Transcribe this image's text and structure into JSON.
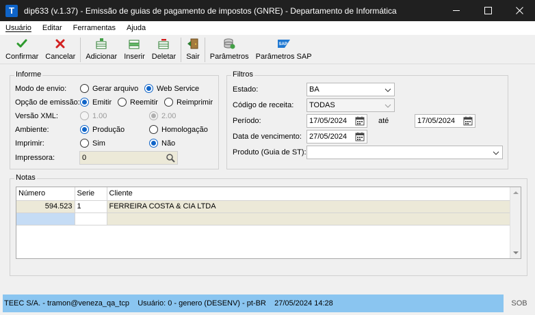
{
  "window": {
    "title": "dip633 (v.1.37) - Emissão de guias de pagamento de impostos (GNRE) - Departamento de Informática",
    "app_icon_letter": "T"
  },
  "menu": [
    "Usuário",
    "Editar",
    "Ferramentas",
    "Ajuda"
  ],
  "toolbar": {
    "confirmar": "Confirmar",
    "cancelar": "Cancelar",
    "adicionar": "Adicionar",
    "inserir": "Inserir",
    "deletar": "Deletar",
    "sair": "Sair",
    "parametros": "Parâmetros",
    "parametros_sap": "Parâmetros SAP",
    "sap_badge": "SAP"
  },
  "informe": {
    "title": "Informe",
    "modo_envio": {
      "label": "Modo de envio:",
      "opt1": "Gerar arquivo",
      "opt2": "Web Service",
      "selected": "Web Service"
    },
    "opcao_emissao": {
      "label": "Opção de emissão:",
      "opt1": "Emitir",
      "opt2": "Reemitir",
      "opt3": "Reimprimir",
      "selected": "Emitir"
    },
    "versao_xml": {
      "label": "Versão XML:",
      "opt1": "1.00",
      "opt2": "2.00",
      "selected": "2.00"
    },
    "ambiente": {
      "label": "Ambiente:",
      "opt1": "Produção",
      "opt2": "Homologação",
      "selected": "Produção"
    },
    "imprimir": {
      "label": "Imprimir:",
      "opt1": "Sim",
      "opt2": "Não",
      "selected": "Não"
    },
    "impressora": {
      "label": "Impressora:",
      "value": "0"
    }
  },
  "filtros": {
    "title": "Filtros",
    "estado": {
      "label": "Estado:",
      "value": "BA"
    },
    "codigo_receita": {
      "label": "Código de receita:",
      "value": "TODAS"
    },
    "periodo": {
      "label": "Período:",
      "from": "17/05/2024",
      "ate": "até",
      "to": "17/05/2024"
    },
    "vencimento": {
      "label": "Data de vencimento:",
      "value": "27/05/2024"
    },
    "produto": {
      "label": "Produto (Guia de ST):",
      "value": ""
    }
  },
  "notas": {
    "title": "Notas",
    "columns": [
      "Número",
      "Serie",
      "Cliente"
    ],
    "rows": [
      {
        "numero": "594.523",
        "serie": "1",
        "cliente": "FERREIRA COSTA & CIA LTDA"
      }
    ]
  },
  "status": {
    "text": "TEEC S/A. - tramon@veneza_qa_tcp    Usuário: 0 - genero (DESENV) - pt-BR    27/05/2024 14:28",
    "right": "SOB"
  },
  "colors": {
    "accent": "#0f64c8",
    "titlebar": "#202020",
    "status_bar": "#8ac5f0",
    "row_highlight": "#ece9d8",
    "selected_cell": "#c5dcf5"
  }
}
